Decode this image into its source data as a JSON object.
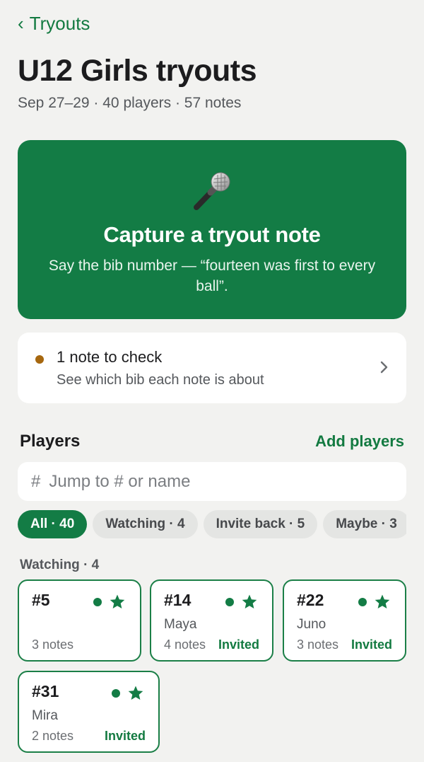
{
  "nav": {
    "back_label": "Tryouts"
  },
  "header": {
    "title": "U12 Girls tryouts",
    "meta": "Sep 27–29 · 40 players · 57 notes"
  },
  "capture": {
    "icon": "microphone-icon",
    "title": "Capture a tryout note",
    "subtitle": "Say the bib number — “fourteen was first to every ball”."
  },
  "review": {
    "title": "1 note to check",
    "subtitle": "See which bib each note is about",
    "dot_color": "#a6670f"
  },
  "players": {
    "section_title": "Players",
    "add_label": "Add players",
    "search": {
      "icon": "#",
      "placeholder": "Jump to # or name",
      "value": ""
    },
    "filters": [
      {
        "label": "All · 40",
        "active": true
      },
      {
        "label": "Watching · 4",
        "active": false
      },
      {
        "label": "Invite back · 5",
        "active": false
      },
      {
        "label": "Maybe · 3",
        "active": false
      }
    ],
    "group_label": "Watching · 4",
    "cards": [
      {
        "number": "#5",
        "name": "",
        "notes": "3 notes",
        "status": ""
      },
      {
        "number": "#14",
        "name": "Maya",
        "notes": "4 notes",
        "status": "Invited"
      },
      {
        "number": "#22",
        "name": "Juno",
        "notes": "3 notes",
        "status": "Invited"
      },
      {
        "number": "#31",
        "name": "Mira",
        "notes": "2 notes",
        "status": "Invited"
      }
    ]
  },
  "colors": {
    "accent": "#137c45",
    "background": "#f2f2f0",
    "warning": "#a6670f"
  }
}
